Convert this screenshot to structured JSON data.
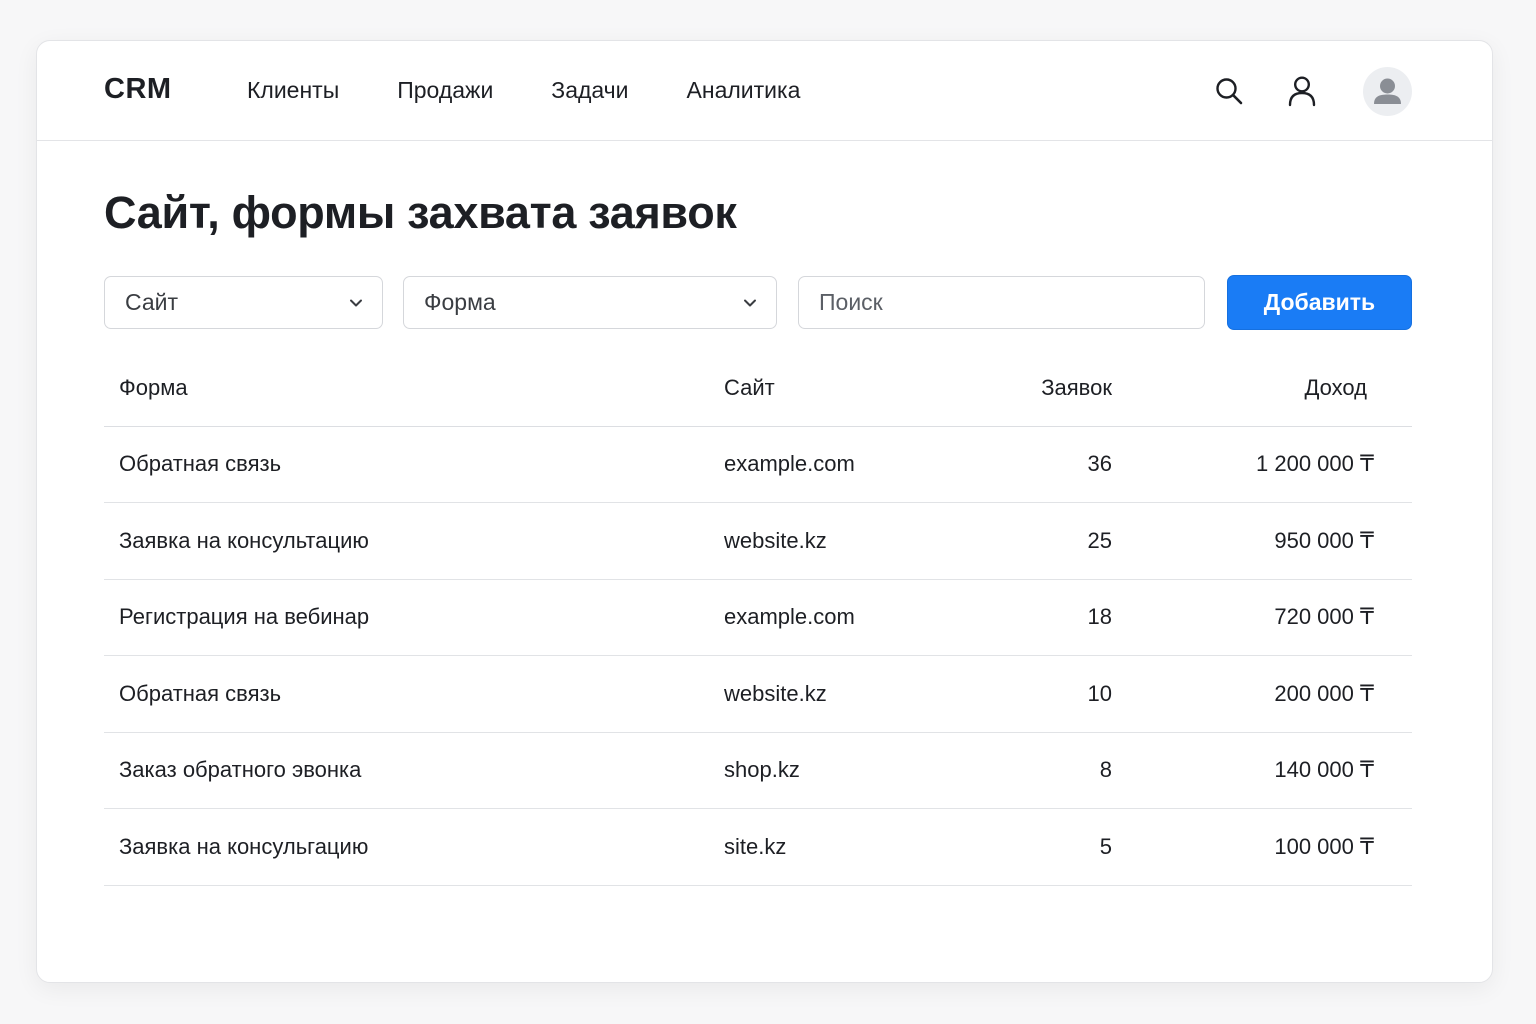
{
  "app": {
    "logo": "CRM"
  },
  "nav": {
    "items": [
      {
        "id": "clients",
        "label": "Клиенты"
      },
      {
        "id": "sales",
        "label": "Продажи"
      },
      {
        "id": "tasks",
        "label": "Задачи"
      },
      {
        "id": "analytics",
        "label": "Аналитика"
      }
    ]
  },
  "header_icons": [
    "search-icon",
    "user-icon",
    "avatar"
  ],
  "page": {
    "title": "Сайт, формы захвата заявок"
  },
  "filters": {
    "site_select": {
      "value": "Сайт"
    },
    "form_select": {
      "value": "Форма"
    },
    "search": {
      "placeholder": "Поиск",
      "value": ""
    },
    "add_button": "Добавить"
  },
  "colors": {
    "accent": "#1a7cf5",
    "border": "#d5d7db",
    "text": "#1d1f24"
  },
  "table": {
    "columns": [
      "Форма",
      "Сайт",
      "Заявок",
      "Доход"
    ],
    "rows": [
      {
        "form": "Обратная связь",
        "site": "example.com",
        "count": "36",
        "revenue": "1 200 000 ₸"
      },
      {
        "form": "Заявка на консультацию",
        "site": "website.kz",
        "count": "25",
        "revenue": "950 000 ₸"
      },
      {
        "form": "Регистрация на вебинар",
        "site": "example.com",
        "count": "18",
        "revenue": "720 000 ₸"
      },
      {
        "form": "Обратная связь",
        "site": "website.kz",
        "count": "10",
        "revenue": "200 000 ₸"
      },
      {
        "form": "Заказ обратного эвонка",
        "site": "shop.kz",
        "count": "8",
        "revenue": "140 000 ₸"
      },
      {
        "form": "Заявка на консульгацию",
        "site": "site.kz",
        "count": "5",
        "revenue": "100 000 ₸"
      }
    ]
  }
}
